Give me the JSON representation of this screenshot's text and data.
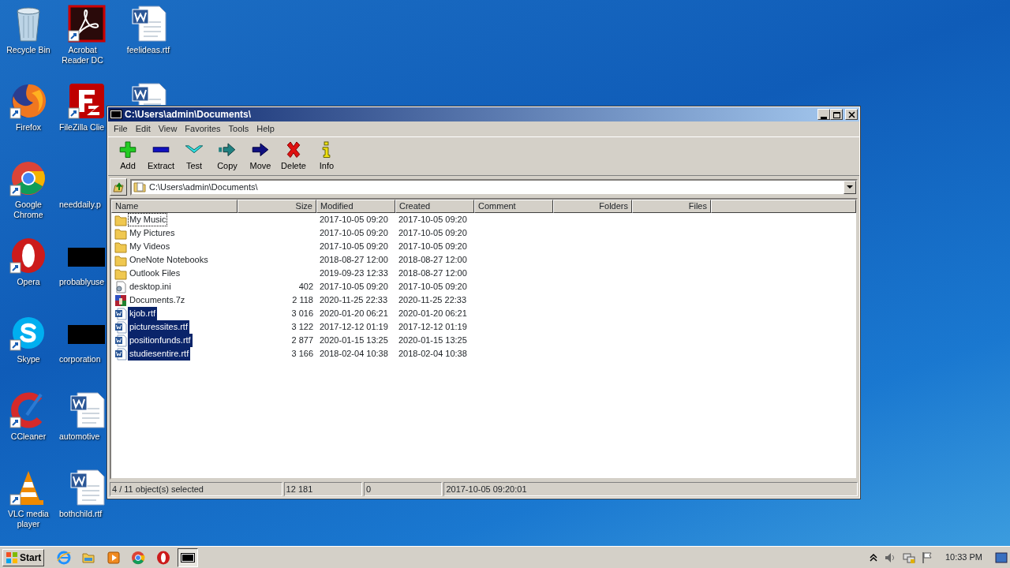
{
  "desktop": {
    "icons": [
      {
        "label": "Recycle Bin",
        "kind": "recycle"
      },
      {
        "label": "Firefox",
        "kind": "firefox",
        "shortcut": true
      },
      {
        "label": "Google Chrome",
        "kind": "chrome",
        "shortcut": true
      },
      {
        "label": "Opera",
        "kind": "opera",
        "shortcut": true
      },
      {
        "label": "Skype",
        "kind": "skype",
        "shortcut": true
      },
      {
        "label": "CCleaner",
        "kind": "ccleaner",
        "shortcut": true
      },
      {
        "label": "VLC media player",
        "kind": "vlc",
        "shortcut": true
      },
      {
        "label": "Acrobat Reader DC",
        "kind": "pdf",
        "shortcut": true
      },
      {
        "label": "FileZilla Clie",
        "kind": "filezilla",
        "shortcut": true
      },
      {
        "label": "needdaily.p",
        "kind": "none"
      },
      {
        "label": "probablyuse",
        "kind": "redacted",
        "shortcut": false
      },
      {
        "label": "corporation",
        "kind": "redacted",
        "shortcut": false
      },
      {
        "label": "automotive",
        "kind": "word"
      },
      {
        "label": "bothchild.rtf",
        "kind": "word"
      },
      {
        "label": "feelideas.rtf",
        "kind": "word"
      },
      {
        "kind": "word"
      }
    ]
  },
  "window": {
    "title": "C:\\Users\\admin\\Documents\\",
    "menu": [
      "File",
      "Edit",
      "View",
      "Favorites",
      "Tools",
      "Help"
    ],
    "toolbar": [
      {
        "label": "Add",
        "kind": "add"
      },
      {
        "label": "Extract",
        "kind": "extract"
      },
      {
        "label": "Test",
        "kind": "test"
      },
      {
        "label": "Copy",
        "kind": "copy"
      },
      {
        "label": "Move",
        "kind": "move"
      },
      {
        "label": "Delete",
        "kind": "delete"
      },
      {
        "label": "Info",
        "kind": "info"
      }
    ],
    "address": "C:\\Users\\admin\\Documents\\",
    "table": {
      "columns": [
        "Name",
        "Size",
        "Modified",
        "Created",
        "Comment",
        "Folders",
        "Files"
      ],
      "rows": [
        {
          "name": "My Music",
          "kind": "folder",
          "size": "",
          "modified": "2017-10-05 09:20",
          "created": "2017-10-05 09:20",
          "selected": false,
          "focused": true
        },
        {
          "name": "My Pictures",
          "kind": "folder",
          "size": "",
          "modified": "2017-10-05 09:20",
          "created": "2017-10-05 09:20",
          "selected": false,
          "focused": false
        },
        {
          "name": "My Videos",
          "kind": "folder",
          "size": "",
          "modified": "2017-10-05 09:20",
          "created": "2017-10-05 09:20",
          "selected": false,
          "focused": false
        },
        {
          "name": "OneNote Notebooks",
          "kind": "folder",
          "size": "",
          "modified": "2018-08-27 12:00",
          "created": "2018-08-27 12:00",
          "selected": false,
          "focused": false
        },
        {
          "name": "Outlook Files",
          "kind": "folder",
          "size": "",
          "modified": "2019-09-23 12:33",
          "created": "2018-08-27 12:00",
          "selected": false,
          "focused": false
        },
        {
          "name": "desktop.ini",
          "kind": "ini",
          "size": "402",
          "modified": "2017-10-05 09:20",
          "created": "2017-10-05 09:20",
          "selected": false,
          "focused": false
        },
        {
          "name": "Documents.7z",
          "kind": "archive",
          "size": "2 118",
          "modified": "2020-11-25 22:33",
          "created": "2020-11-25 22:33",
          "selected": false,
          "focused": false
        },
        {
          "name": "kjob.rtf",
          "kind": "rtf",
          "size": "3 016",
          "modified": "2020-01-20 06:21",
          "created": "2020-01-20 06:21",
          "selected": true,
          "focused": false
        },
        {
          "name": "picturessites.rtf",
          "kind": "rtf",
          "size": "3 122",
          "modified": "2017-12-12 01:19",
          "created": "2017-12-12 01:19",
          "selected": true,
          "focused": false
        },
        {
          "name": "positionfunds.rtf",
          "kind": "rtf",
          "size": "2 877",
          "modified": "2020-01-15 13:25",
          "created": "2020-01-15 13:25",
          "selected": true,
          "focused": false
        },
        {
          "name": "studiesentire.rtf",
          "kind": "rtf",
          "size": "3 166",
          "modified": "2018-02-04 10:38",
          "created": "2018-02-04 10:38",
          "selected": true,
          "focused": false
        }
      ]
    },
    "status_bar": [
      "4 / 11 object(s) selected",
      "12 181",
      "0",
      "2017-10-05 09:20:01"
    ]
  },
  "taskbar": {
    "start": "Start",
    "apps": [
      {
        "kind": "ie",
        "active": false
      },
      {
        "kind": "explorer",
        "active": false
      },
      {
        "kind": "media",
        "active": false
      },
      {
        "kind": "chrome",
        "active": false
      },
      {
        "kind": "opera",
        "active": false
      },
      {
        "kind": "sevenzip",
        "active": true
      }
    ],
    "clock": "10:33 PM"
  }
}
